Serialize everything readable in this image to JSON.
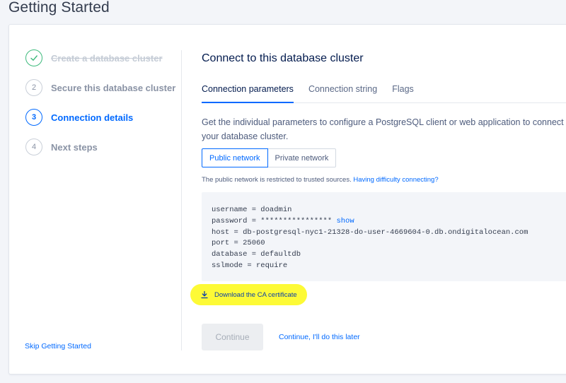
{
  "page_title": "Getting Started",
  "steps": [
    {
      "num": "",
      "label": "Create a database cluster",
      "state": "done"
    },
    {
      "num": "2",
      "label": "Secure this database cluster",
      "state": "pending"
    },
    {
      "num": "3",
      "label": "Connection details",
      "state": "active"
    },
    {
      "num": "4",
      "label": "Next steps",
      "state": "pending"
    }
  ],
  "skip_label": "Skip Getting Started",
  "main": {
    "title": "Connect to this database cluster",
    "tabs": [
      {
        "label": "Connection parameters",
        "active": true
      },
      {
        "label": "Connection string",
        "active": false
      },
      {
        "label": "Flags",
        "active": false
      }
    ],
    "description_line1": "Get the individual parameters to configure a PostgreSQL client or web application to connect to",
    "description_line2": "your database cluster.",
    "network_toggle": {
      "public": "Public network",
      "private": "Private network"
    },
    "note_text": "The public network is restricted to trusted sources.",
    "note_link": "Having difficulty connecting?",
    "params": {
      "username": "username = doadmin",
      "password": "password = ****************",
      "password_show": "show",
      "host": "host = db-postgresql-nyc1-21328-do-user-4669604-0.db.ondigitalocean.com",
      "port": "port = 25060",
      "database": "database = defaultdb",
      "sslmode": "sslmode = require"
    },
    "download_label": "Download the CA certificate",
    "continue_label": "Continue",
    "later_label": "Continue, I'll do this later"
  },
  "colors": {
    "accent": "#0069ff",
    "done_green": "#3dba7c",
    "highlight": "#fdfa36"
  },
  "icons": {
    "step_done": "check-icon",
    "download": "download-icon"
  }
}
